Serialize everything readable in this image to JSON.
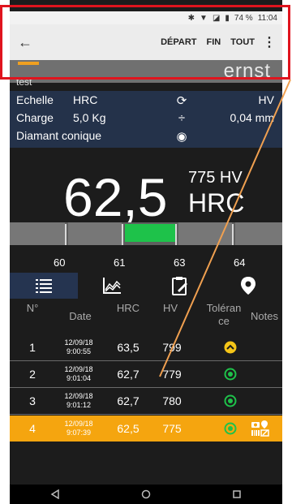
{
  "status_bar": {
    "icons": [
      "bluetooth-icon",
      "wifi-icon",
      "no-sim-icon",
      "battery-icon"
    ],
    "battery": "74 %",
    "time": "11:04"
  },
  "action_bar": {
    "back_icon": "arrow-left-icon",
    "actions": [
      "DÉPART",
      "FIN",
      "TOUT"
    ],
    "more_icon": "kebab-menu-icon"
  },
  "header": {
    "sample_name": "test",
    "logo_text": "ernst"
  },
  "params": {
    "scale_label": "Echelle",
    "scale_value": "HRC",
    "load_label": "Charge",
    "load_value": "5,0 Kg",
    "indenter": "Diamant conique",
    "right_scale": "HV",
    "right_depth": "0,04 mm"
  },
  "measurement": {
    "value": "62,5",
    "unit": "HRC",
    "hv": "775 HV"
  },
  "scale_ticks": [
    "60",
    "61",
    "63",
    "64"
  ],
  "tabs": [
    "list-icon",
    "chart-icon",
    "clipboard-icon",
    "location-pin-icon"
  ],
  "table": {
    "headers": [
      "N°",
      "Date",
      "HRC",
      "HV",
      "Toléran ce",
      "Notes"
    ],
    "rows": [
      {
        "n": "1",
        "date": "12/09/18",
        "time": "9:00:55",
        "hrc": "63,5",
        "hv": "799",
        "tol": "up"
      },
      {
        "n": "2",
        "date": "12/09/18",
        "time": "9:01:04",
        "hrc": "62,7",
        "hv": "779",
        "tol": "ok"
      },
      {
        "n": "3",
        "date": "12/09/18",
        "time": "9:01:12",
        "hrc": "62,7",
        "hv": "780",
        "tol": "ok"
      },
      {
        "n": "4",
        "date": "12/09/18",
        "time": "9:07:39",
        "hrc": "62,5",
        "hv": "775",
        "tol": "ok",
        "selected": true
      }
    ]
  },
  "navbar": [
    "back-triangle-icon",
    "home-circle-icon",
    "recents-square-icon"
  ],
  "colors": {
    "accent": "#f5a50f",
    "green": "#1ec24a",
    "navy": "#24324a",
    "annotation_red": "#e0141e",
    "annotation_orange": "#f0a050"
  }
}
